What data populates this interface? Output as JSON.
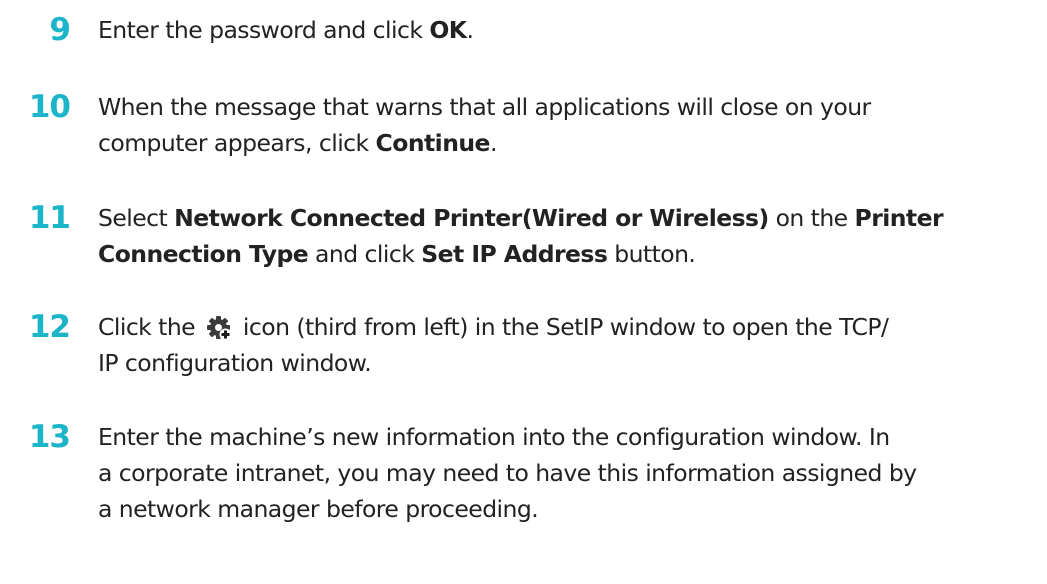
{
  "steps": [
    {
      "number": "9",
      "lines": [
        [
          {
            "text": "Enter the password and click ",
            "bold": false
          },
          {
            "text": "OK",
            "bold": true
          },
          {
            "text": ".",
            "bold": false
          }
        ]
      ]
    },
    {
      "number": "10",
      "lines": [
        [
          {
            "text": "When the message that warns that all applications will close on your",
            "bold": false
          }
        ],
        [
          {
            "text": "computer appears, click ",
            "bold": false
          },
          {
            "text": "Continue",
            "bold": true
          },
          {
            "text": ".",
            "bold": false
          }
        ]
      ]
    },
    {
      "number": "11",
      "lines": [
        [
          {
            "text": "Select ",
            "bold": false
          },
          {
            "text": "Network Connected Printer(Wired or Wireless)",
            "bold": true
          },
          {
            "text": " on the ",
            "bold": false
          },
          {
            "text": "Printer",
            "bold": true
          }
        ],
        [
          {
            "text": "Connection Type",
            "bold": true
          },
          {
            "text": " and click ",
            "bold": false
          },
          {
            "text": "Set IP Address",
            "bold": true
          },
          {
            "text": " button.",
            "bold": false
          }
        ]
      ]
    },
    {
      "number": "12",
      "lines": [
        [
          {
            "text": "Click the ",
            "bold": false
          },
          {
            "icon": "gear-plus-icon"
          },
          {
            "text": " icon (third from left) in the SetIP window to open the TCP/",
            "bold": false
          }
        ],
        [
          {
            "text": "IP configuration window.",
            "bold": false
          }
        ]
      ]
    },
    {
      "number": "13",
      "lines": [
        [
          {
            "text": "Enter the machine’s new information into the configuration window. In",
            "bold": false
          }
        ],
        [
          {
            "text": "a corporate intranet, you may need to have this information assigned by",
            "bold": false
          }
        ],
        [
          {
            "text": "a network manager before proceeding.",
            "bold": false
          }
        ]
      ]
    }
  ],
  "colors": {
    "step_number": "#1bb4c8",
    "text": "#222222"
  }
}
